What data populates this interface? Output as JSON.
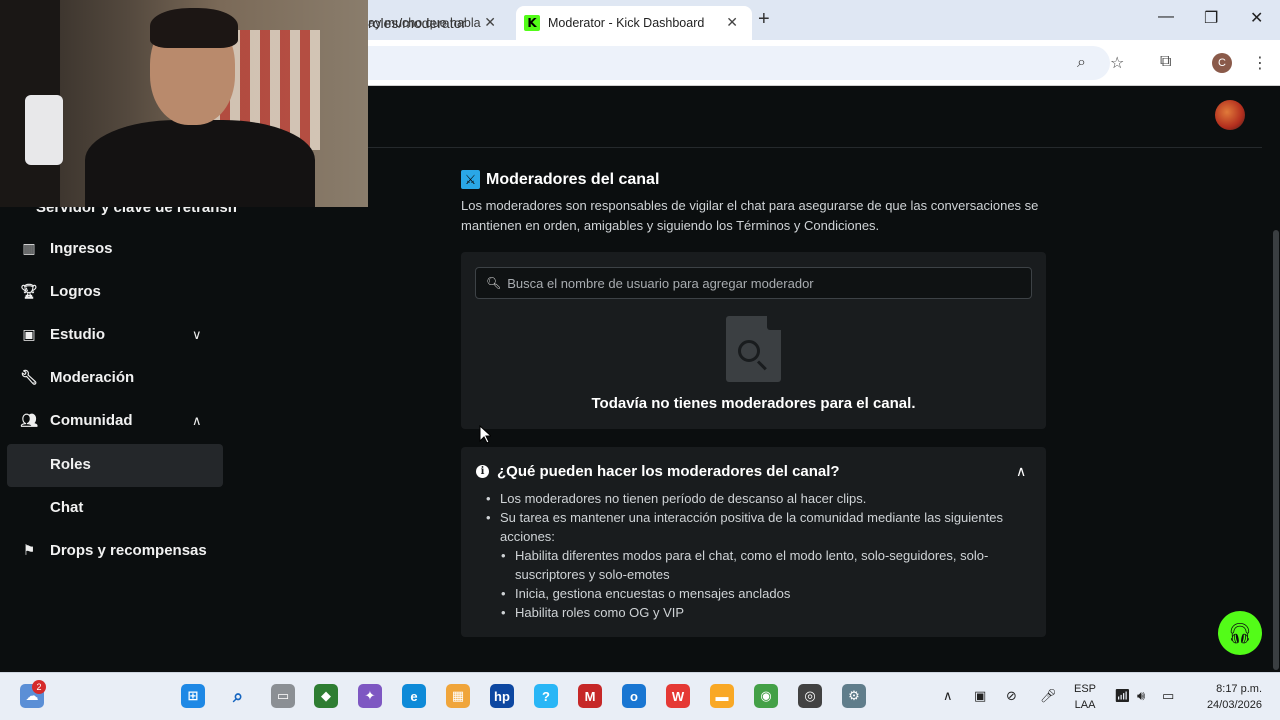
{
  "browser": {
    "inactive_tab_title": "ay mucho que habla",
    "active_tab_title": "Moderator - Kick Dashboard",
    "new_tab_symbol": "+",
    "url_fragment": "roles/moderator",
    "profile_initial": "C"
  },
  "sidebar": {
    "partial_item": "Servidor y clave de retransn",
    "items": [
      {
        "label": "Ingresos",
        "icon": "bar-chart-icon"
      },
      {
        "label": "Logros",
        "icon": "trophy-icon"
      },
      {
        "label": "Estudio",
        "icon": "studio-icon"
      },
      {
        "label": "Moderación",
        "icon": "wrench-icon"
      },
      {
        "label": "Comunidad",
        "icon": "users-icon"
      },
      {
        "label": "Drops y recompensas",
        "icon": "drops-icon"
      }
    ],
    "sub_items": [
      "Roles",
      "Chat"
    ],
    "selected": "Roles"
  },
  "main": {
    "title": "Moderadores del canal",
    "description": "Los moderadores son responsables de vigilar el chat para asegurarse de que las conversaciones se mantienen en orden, amigables y siguiendo los Términos y Condiciones.",
    "search_placeholder": "Busca el nombre de usuario para agregar moderador",
    "empty_text": "Todavía no tienes moderadores para el canal.",
    "faq": {
      "title": "¿Qué pueden hacer los moderadores del canal?",
      "items": [
        "Los moderadores no tienen período de descanso al hacer clips.",
        "Su tarea es mantener una interacción positiva de la comunidad mediante las siguientes acciones:"
      ],
      "sub_items": [
        "Habilita diferentes modos para el chat, como el modo lento, solo-seguidores, solo-suscriptores y solo-emotes",
        "Inicia, gestiona encuestas o mensajes anclados",
        "Habilita roles como OG y VIP"
      ]
    }
  },
  "taskbar": {
    "weather_badge": "2",
    "lang_top": "ESP",
    "lang_bottom": "LAA",
    "time": "8:17 p.m.",
    "date": "24/03/2026"
  },
  "colors": {
    "kick_green": "#53fc18",
    "page_bg": "#0b0e0f",
    "card_bg": "#191c1e",
    "title_icon": "#2aa7e6"
  }
}
